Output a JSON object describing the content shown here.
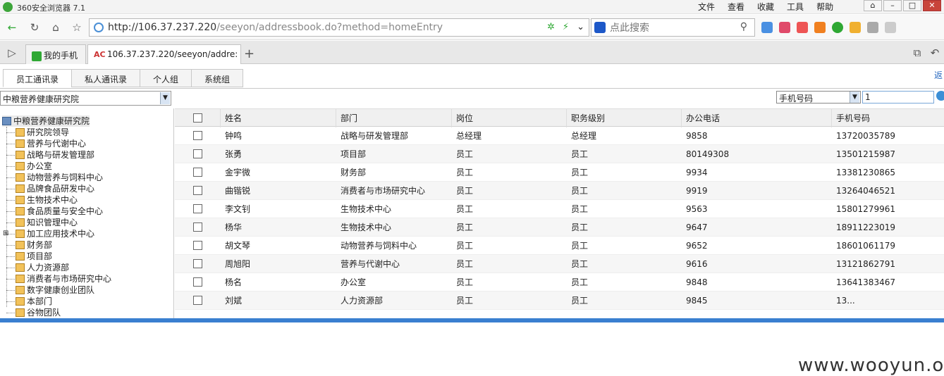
{
  "browser": {
    "title": "360安全浏览器 7.1",
    "menu": [
      "文件",
      "查看",
      "收藏",
      "工具",
      "帮助"
    ],
    "url_host": "http://106.37.237.220",
    "url_path": "/seeyon/addressbook.do?method=homeEntry",
    "search_placeholder": "点此搜索",
    "tabs": [
      {
        "label": "我的手机"
      },
      {
        "label": "106.37.237.220/seeyon/addre:"
      }
    ]
  },
  "page": {
    "top_tabs": [
      "员工通讯录",
      "私人通讯录",
      "个人组",
      "系统组"
    ],
    "back_label": "返",
    "org_select": "中粮营养健康研究院",
    "tree": {
      "root": "中粮营养健康研究院",
      "children": [
        "研究院领导",
        "营养与代谢中心",
        "战略与研发管理部",
        "办公室",
        "动物营养与饲料中心",
        "品牌食品研发中心",
        "生物技术中心",
        "食品质量与安全中心",
        "知识管理中心",
        "加工应用技术中心",
        "财务部",
        "项目部",
        "人力资源部",
        "消费者与市场研究中心",
        "数字健康创业团队",
        "本部门",
        "谷物团队"
      ],
      "expandable_index": 9
    },
    "search": {
      "field": "手机号码",
      "query": "1"
    },
    "table": {
      "columns": [
        "姓名",
        "部门",
        "岗位",
        "职务级别",
        "办公电话",
        "手机号码"
      ],
      "rows": [
        [
          "钟鸣",
          "战略与研发管理部",
          "总经理",
          "总经理",
          "9858",
          "13720035789"
        ],
        [
          "张勇",
          "项目部",
          "员工",
          "员工",
          "80149308",
          "13501215987"
        ],
        [
          "金宇微",
          "财务部",
          "员工",
          "员工",
          "9934",
          "13381230865"
        ],
        [
          "曲锴锐",
          "消费者与市场研究中心",
          "员工",
          "员工",
          "9919",
          "13264046521"
        ],
        [
          "李文钊",
          "生物技术中心",
          "员工",
          "员工",
          "9563",
          "15801279961"
        ],
        [
          "杨华",
          "生物技术中心",
          "员工",
          "员工",
          "9647",
          "18911223019"
        ],
        [
          "胡文琴",
          "动物营养与饲料中心",
          "员工",
          "员工",
          "9652",
          "18601061179"
        ],
        [
          "周旭阳",
          "营养与代谢中心",
          "员工",
          "员工",
          "9616",
          "13121862791"
        ],
        [
          "杨名",
          "办公室",
          "员工",
          "员工",
          "9848",
          "13641383467"
        ],
        [
          "刘斌",
          "人力资源部",
          "员工",
          "员工",
          "9845",
          "13..."
        ]
      ]
    }
  },
  "watermark": "www.wooyun.org",
  "colors": {
    "accent": "#3a7fd0",
    "tab_icon_green": "#2fa834"
  }
}
